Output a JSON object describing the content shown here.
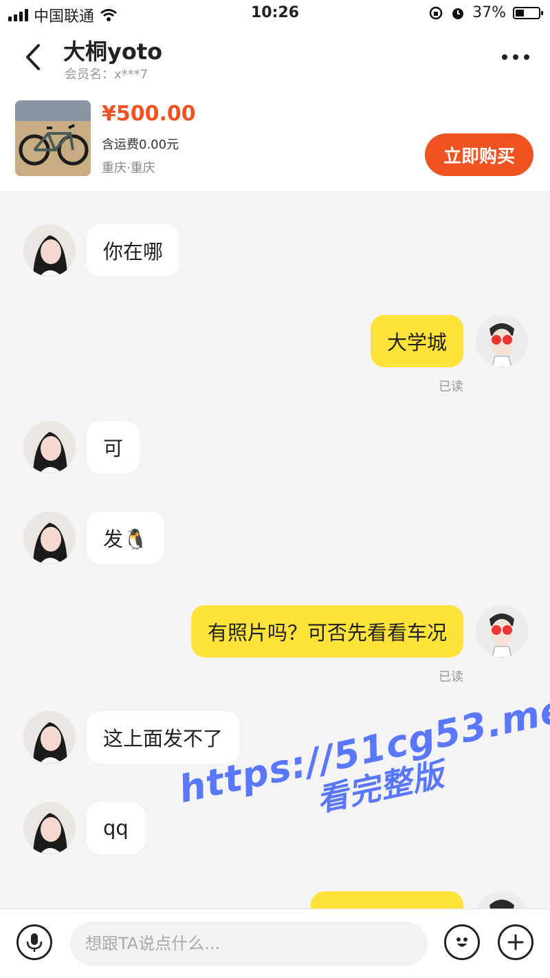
{
  "status_bar": {
    "carrier": "中国联通",
    "time": "10:26",
    "battery": "37%",
    "battery_level": 0.37
  },
  "header": {
    "title": "大桐yoto",
    "member": "会员名：x***7"
  },
  "product": {
    "price": "¥500.00",
    "shipping": "含运费0.00元",
    "location": "重庆·重庆",
    "buy_label": "立即购买"
  },
  "messages": [
    {
      "side": "in",
      "text": "你在哪"
    },
    {
      "side": "out",
      "text": "大学城",
      "status": "已读"
    },
    {
      "side": "in",
      "text": "可"
    },
    {
      "side": "in",
      "text": "发🐧"
    },
    {
      "side": "out",
      "text": "有照片吗？可否先看看车况",
      "status": "已读"
    },
    {
      "side": "in",
      "text": "这上面发不了"
    },
    {
      "side": "in",
      "text": "qq"
    }
  ],
  "watermark": {
    "line1": "https://51cg53.me",
    "line2": "看完整版"
  },
  "input": {
    "placeholder": "想跟TA说点什么..."
  },
  "colors": {
    "accent": "#ef5322",
    "out_bubble": "#ffe33a",
    "watermark": "#5a78ff"
  }
}
